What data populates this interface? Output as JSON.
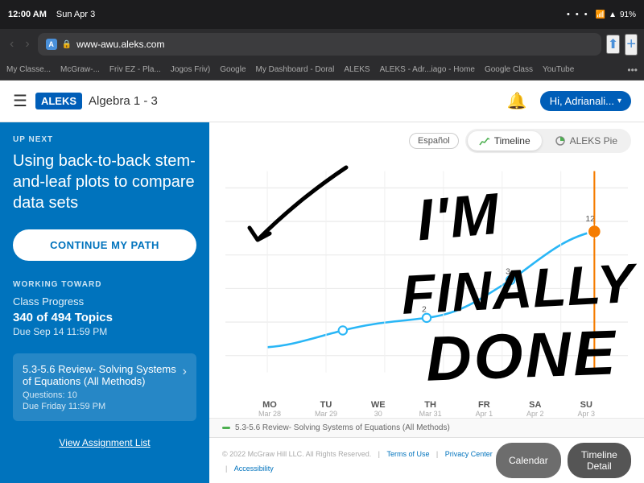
{
  "browser": {
    "time": "12:00 AM",
    "date": "Sun Apr 3",
    "battery": "91%",
    "url": "www-awu.aleks.com",
    "url_secure": true,
    "bookmarks": [
      "My Classe...",
      "McGraw-...",
      "Friv EZ - Pla...",
      "Jogos Friv)",
      "Google",
      "My Dashboard - Doral",
      "ALEKS",
      "ALEKS - Adr...iago - Home",
      "Google Class",
      "YouTube"
    ]
  },
  "aleks": {
    "header": {
      "course": "Algebra 1 - 3",
      "user": "Hi, Adrianali...",
      "logo": "ALEKS"
    },
    "up_next": {
      "label": "UP NEXT",
      "title": "Using back-to-back stem-and-leaf plots to compare data sets",
      "button": "CONTINUE MY PATH"
    },
    "working_toward": {
      "label": "WORKING TOWARD",
      "section": "Class Progress",
      "topics": "340 of 494 Topics",
      "due": "Due Sep 14 11:59 PM"
    },
    "assignment": {
      "title": "5.3-5.6 Review- Solving Systems of Equations (All Methods)",
      "questions": "Questions: 10",
      "due": "Due Friday 11:59 PM"
    },
    "view_assignment": "View Assignment List",
    "tabs": {
      "timeline": "Timeline",
      "aleks_pie": "ALEKS Pie"
    },
    "espanol": "Español",
    "chart_legend": "5.3-5.6 Review- Solving Systems of Equations (All Methods)",
    "x_labels": [
      {
        "day": "MO",
        "date": "Mar 28"
      },
      {
        "day": "TU",
        "date": "Mar 29"
      },
      {
        "day": "WE",
        "date": "30"
      },
      {
        "day": "TH",
        "date": "Mar 31"
      },
      {
        "day": "FR",
        "date": "Apr 1"
      },
      {
        "day": "SA",
        "date": "Apr 2"
      },
      {
        "day": "SU",
        "date": "Apr 3"
      }
    ],
    "footer": {
      "copyright": "© 2022 McGraw Hill LLC. All Rights Reserved.",
      "links": [
        "Terms of Use",
        "Privacy Center",
        "Accessibility"
      ]
    },
    "buttons": {
      "calendar": "Calendar",
      "timeline_detail": "Timeline Detail"
    }
  },
  "handwriting": "I'M FINALLY DONE"
}
